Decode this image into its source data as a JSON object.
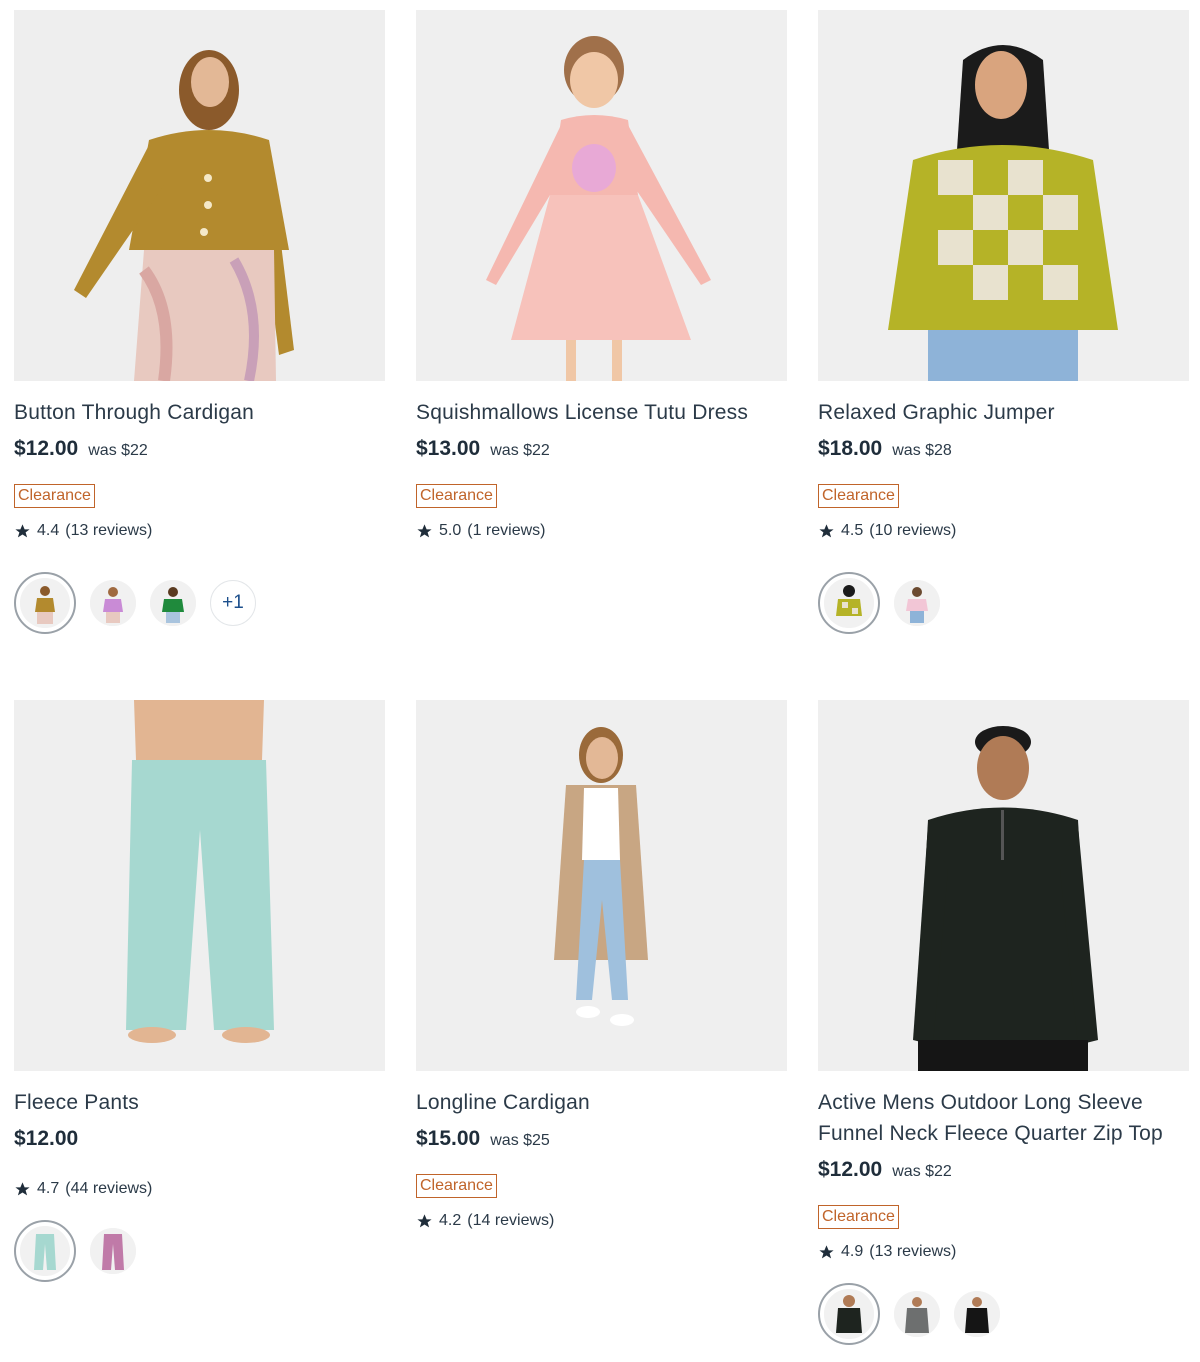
{
  "products": [
    {
      "title": "Button Through Cardigan",
      "price": "$12.00",
      "was": "was $22",
      "badge": "Clearance",
      "rating": "4.4",
      "reviews": "(13 reviews)",
      "more": "+1",
      "colors": {
        "main": "#b38a2e",
        "bg": "#eeeeee",
        "bottom": "#e8c9c0",
        "skin": "#e3b896",
        "hair": "#8b5a2b"
      },
      "swatch_colors": [
        "#b38a2e",
        "#c98bd6",
        "#1f8a3c"
      ]
    },
    {
      "title": "Squishmallows License Tutu Dress",
      "price": "$13.00",
      "was": "was $22",
      "badge": "Clearance",
      "rating": "5.0",
      "reviews": "(1 reviews)",
      "colors": {
        "main": "#f5b8b0",
        "bg": "#efefef",
        "bottom": "#f7c2bb",
        "skin": "#f0c7a6",
        "hair": "#a0704a"
      }
    },
    {
      "title": "Relaxed Graphic Jumper",
      "price": "$18.00",
      "was": "was $28",
      "badge": "Clearance",
      "rating": "4.5",
      "reviews": "(10 reviews)",
      "colors": {
        "main": "#b5b327",
        "accent": "#e8e2cf",
        "bg": "#efefef",
        "bottom": "#8eb3d8",
        "skin": "#d9a47e",
        "hair": "#1b1b1b"
      },
      "swatch_colors": [
        "#b5b327",
        "#f2c6d6"
      ]
    },
    {
      "title": "Fleece Pants",
      "price": "$12.00",
      "rating": "4.7",
      "reviews": "(44 reviews)",
      "colors": {
        "main": "#a6d8d0",
        "bg": "#efefef",
        "skin": "#e2b592"
      },
      "swatch_colors": [
        "#a6d8d0",
        "#c07aa8"
      ]
    },
    {
      "title": "Longline Cardigan",
      "price": "$15.00",
      "was": "was $25",
      "badge": "Clearance",
      "rating": "4.2",
      "reviews": "(14 reviews)",
      "colors": {
        "main": "#c8a683",
        "bg": "#efefef",
        "bottom": "#9fc0dd",
        "skin": "#e3b896",
        "hair": "#9a6a3a"
      }
    },
    {
      "title_line1": "Active Mens Outdoor Long Sleeve",
      "title_line2": "Funnel Neck Fleece Quarter Zip Top",
      "price": "$12.00",
      "was": "was $22",
      "badge": "Clearance",
      "rating": "4.9",
      "reviews": "(13 reviews)",
      "colors": {
        "main": "#1e241f",
        "bg": "#efefef",
        "skin": "#b07b56",
        "hair": "#1a1a1a"
      },
      "swatch_colors": [
        "#1e241f",
        "#6d6f6f",
        "#151515"
      ]
    }
  ]
}
